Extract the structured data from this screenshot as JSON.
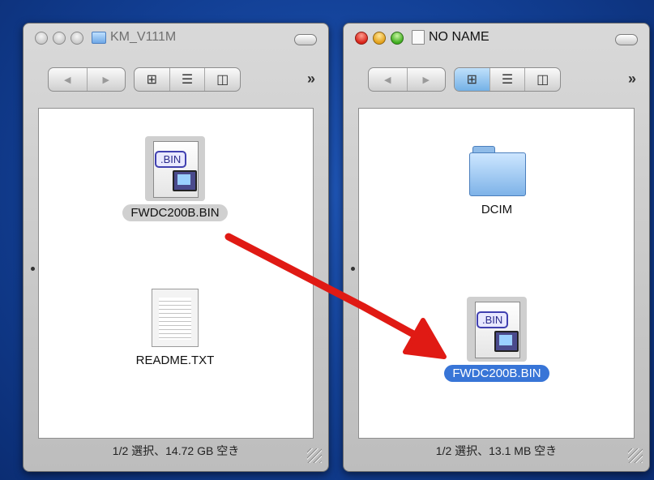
{
  "left_window": {
    "title": "KM_V111M",
    "toolbar": {
      "back": "◀",
      "forward": "▶",
      "more": "»",
      "views": [
        "icon",
        "list",
        "column"
      ]
    },
    "items": [
      {
        "name": "FWDC200B.BIN",
        "badge": ".BIN",
        "selected": true
      },
      {
        "name": "README.TXT"
      }
    ],
    "status": "1/2 選択、14.72 GB 空き"
  },
  "right_window": {
    "title": "NO NAME",
    "toolbar": {
      "back": "◀",
      "forward": "▶",
      "more": "»",
      "views": [
        "icon",
        "list",
        "column"
      ],
      "active_view": "icon"
    },
    "items": [
      {
        "name": "DCIM"
      },
      {
        "name": "FWDC200B.BIN",
        "badge": ".BIN",
        "selected": true
      }
    ],
    "status": "1/2 選択、13.1 MB 空き"
  },
  "annotation": {
    "arrow_color": "#e01a14"
  },
  "colors": {
    "desktop": "#1a4aa8",
    "selection": "#3875d7"
  }
}
